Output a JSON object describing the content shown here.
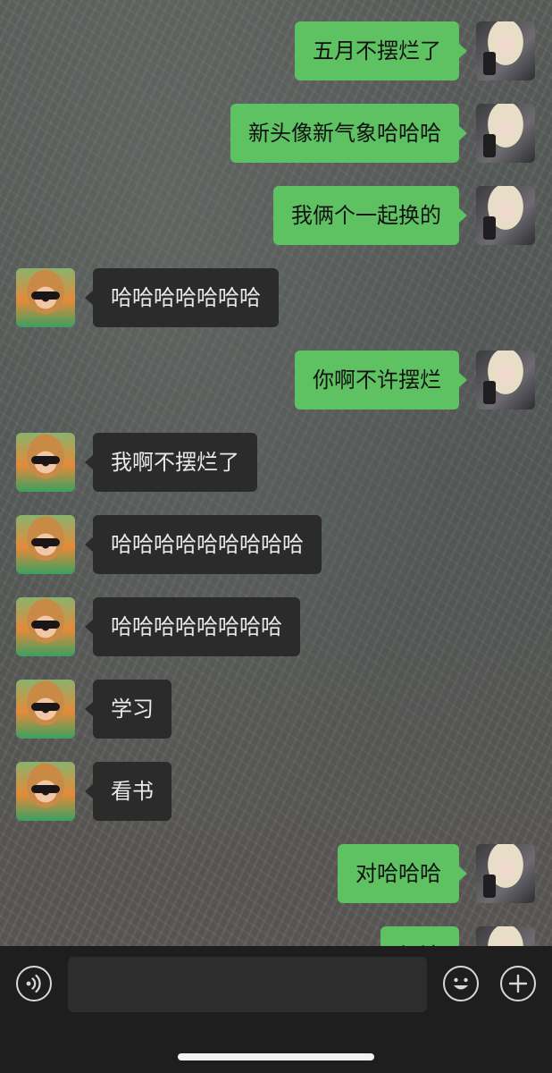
{
  "messages": [
    {
      "side": "right",
      "text": "五月不摆烂了",
      "avatar": "blonde-avatar"
    },
    {
      "side": "right",
      "text": "新头像新气象哈哈哈",
      "avatar": "blonde-avatar"
    },
    {
      "side": "right",
      "text": "我俩个一起换的",
      "avatar": "blonde-avatar"
    },
    {
      "side": "left",
      "text": "哈哈哈哈哈哈哈",
      "avatar": "redhead-avatar"
    },
    {
      "side": "right",
      "text": "你啊不许摆烂",
      "avatar": "blonde-avatar"
    },
    {
      "side": "left",
      "text": "我啊不摆烂了",
      "avatar": "redhead-avatar"
    },
    {
      "side": "left",
      "text": "哈哈哈哈哈哈哈哈哈",
      "avatar": "redhead-avatar"
    },
    {
      "side": "left",
      "text": "哈哈哈哈哈哈哈哈",
      "avatar": "redhead-avatar"
    },
    {
      "side": "left",
      "text": "学习",
      "avatar": "redhead-avatar"
    },
    {
      "side": "left",
      "text": "看书",
      "avatar": "redhead-avatar"
    },
    {
      "side": "right",
      "text": "对哈哈哈",
      "avatar": "blonde-avatar"
    },
    {
      "side": "right",
      "text": "加油",
      "avatar": "blonde-avatar"
    }
  ],
  "input_bar": {
    "voice_icon": "voice-icon",
    "emoji_icon": "emoji-icon",
    "plus_icon": "plus-icon",
    "input_value": ""
  },
  "colors": {
    "sent_bubble": "#5ec162",
    "received_bubble": "#2b2b2b",
    "bottom_bar": "#1e1e1e"
  }
}
